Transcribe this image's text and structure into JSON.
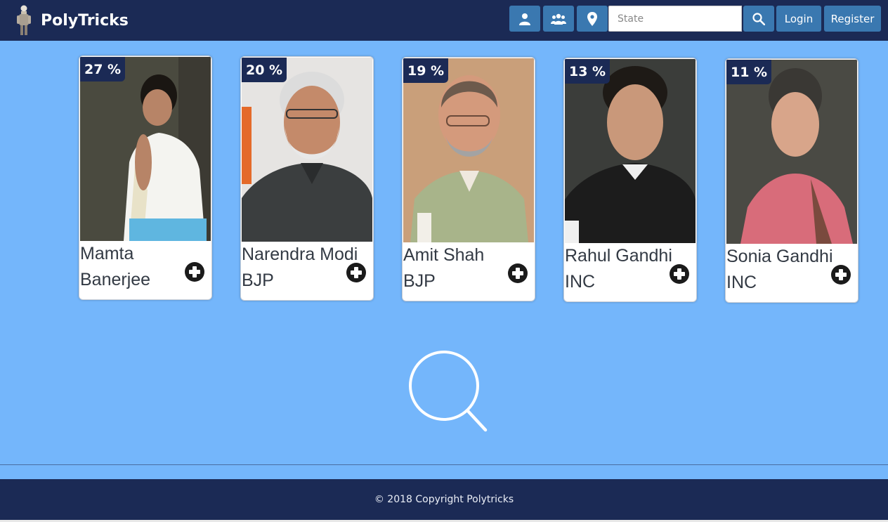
{
  "header": {
    "brand": "PolyTricks",
    "state_placeholder": "State",
    "login_label": "Login",
    "register_label": "Register",
    "icons": [
      "person-icon",
      "group-icon",
      "location-pin-icon",
      "search-icon"
    ]
  },
  "cards": [
    {
      "percent": "27 %",
      "name": "Mamta",
      "party": "Banerjee"
    },
    {
      "percent": "20 %",
      "name": "Narendra Modi",
      "party": "BJP"
    },
    {
      "percent": "19 %",
      "name": "Amit Shah",
      "party": "BJP"
    },
    {
      "percent": "13 %",
      "name": "Rahul Gandhi",
      "party": "INC"
    },
    {
      "percent": "11 %",
      "name": "Sonia Gandhi",
      "party": "INC"
    }
  ],
  "footer": {
    "copyright": "© 2018 Copyright Polytricks"
  },
  "colors": {
    "navy": "#1b2a55",
    "background": "#74b6fb",
    "button": "#3a78b0"
  }
}
